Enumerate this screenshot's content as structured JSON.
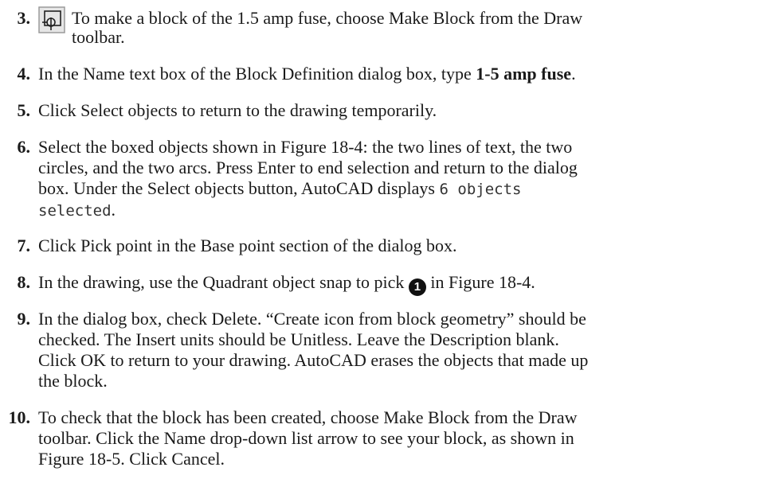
{
  "steps": [
    {
      "num": "3.",
      "lines": [
        "To make a block of the 1.5 amp fuse, choose Make Block from the Draw",
        "toolbar."
      ],
      "icon": "make-block-icon"
    },
    {
      "num": "4.",
      "prefix": "In the Name text box of the Block Definition dialog box, type ",
      "bold": "1-5 amp fuse",
      "suffix": "."
    },
    {
      "num": "5.",
      "text": "Click Select objects to return to the drawing temporarily."
    },
    {
      "num": "6.",
      "line1": "Select the boxed objects shown in Figure 18-4: the two lines of text, the two",
      "line2": "circles, and the two arcs. Press Enter to end selection and return to the dialog",
      "line3_prefix": "box. Under the Select objects button, AutoCAD displays ",
      "line3_mono": "6 objects",
      "line4_mono": "selected",
      "line4_suffix": "."
    },
    {
      "num": "7.",
      "text": "Click Pick point in the Base point section of the dialog box."
    },
    {
      "num": "8.",
      "prefix": "In the drawing, use the Quadrant object snap to pick ",
      "callout": "1",
      "suffix": " in Figure 18-4."
    },
    {
      "num": "9.",
      "lines": [
        "In the dialog box, check Delete. “Create icon from block geometry” should be",
        "checked. The Insert units should be Unitless. Leave the Description blank.",
        "Click OK to return to your drawing. AutoCAD erases the objects that made up",
        "the block."
      ]
    },
    {
      "num": "10.",
      "lines": [
        "To check that the block has been created, choose Make Block from the Draw",
        "toolbar. Click the Name drop-down list arrow to see your block, as shown in",
        "Figure 18-5. Click Cancel."
      ]
    }
  ]
}
